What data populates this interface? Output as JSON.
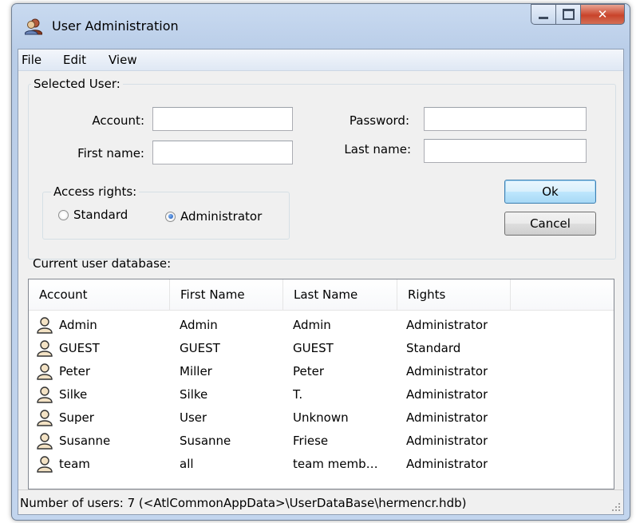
{
  "window": {
    "title": "User Administration"
  },
  "menu": [
    "File",
    "Edit",
    "View"
  ],
  "selected_user": {
    "group_label": "Selected User:",
    "account_label": "Account:",
    "account_value": "",
    "password_label": "Password:",
    "password_value": "",
    "first_name_label": "First name:",
    "first_name_value": "",
    "last_name_label": "Last name:",
    "last_name_value": ""
  },
  "access_rights": {
    "group_label": "Access rights:",
    "standard_label": "Standard",
    "administrator_label": "Administrator",
    "selected": "Administrator"
  },
  "buttons": {
    "ok": "Ok",
    "cancel": "Cancel"
  },
  "database": {
    "label": "Current user database:",
    "columns": [
      "Account",
      "First Name",
      "Last Name",
      "Rights"
    ],
    "rows": [
      [
        "Admin",
        "Admin",
        "Admin",
        "Administrator"
      ],
      [
        "GUEST",
        "GUEST",
        "GUEST",
        "Standard"
      ],
      [
        "Peter",
        "Miller",
        "Peter",
        "Administrator"
      ],
      [
        "Silke",
        "Silke",
        "T.",
        "Administrator"
      ],
      [
        "Super",
        "User",
        "Unknown",
        "Administrator"
      ],
      [
        "Susanne",
        "Susanne",
        "Friese",
        "Administrator"
      ],
      [
        "team",
        "all",
        "team memb…",
        "Administrator"
      ]
    ]
  },
  "status": {
    "text": "Number of users: 7  (<AtlCommonAppData>\\UserDataBase\\hermencr.hdb)"
  },
  "colors": {
    "title_bg": "#c9daf0",
    "close_button": "#c9442b",
    "client_bg": "#f0f0f0",
    "default_button": "#bee6fd"
  }
}
